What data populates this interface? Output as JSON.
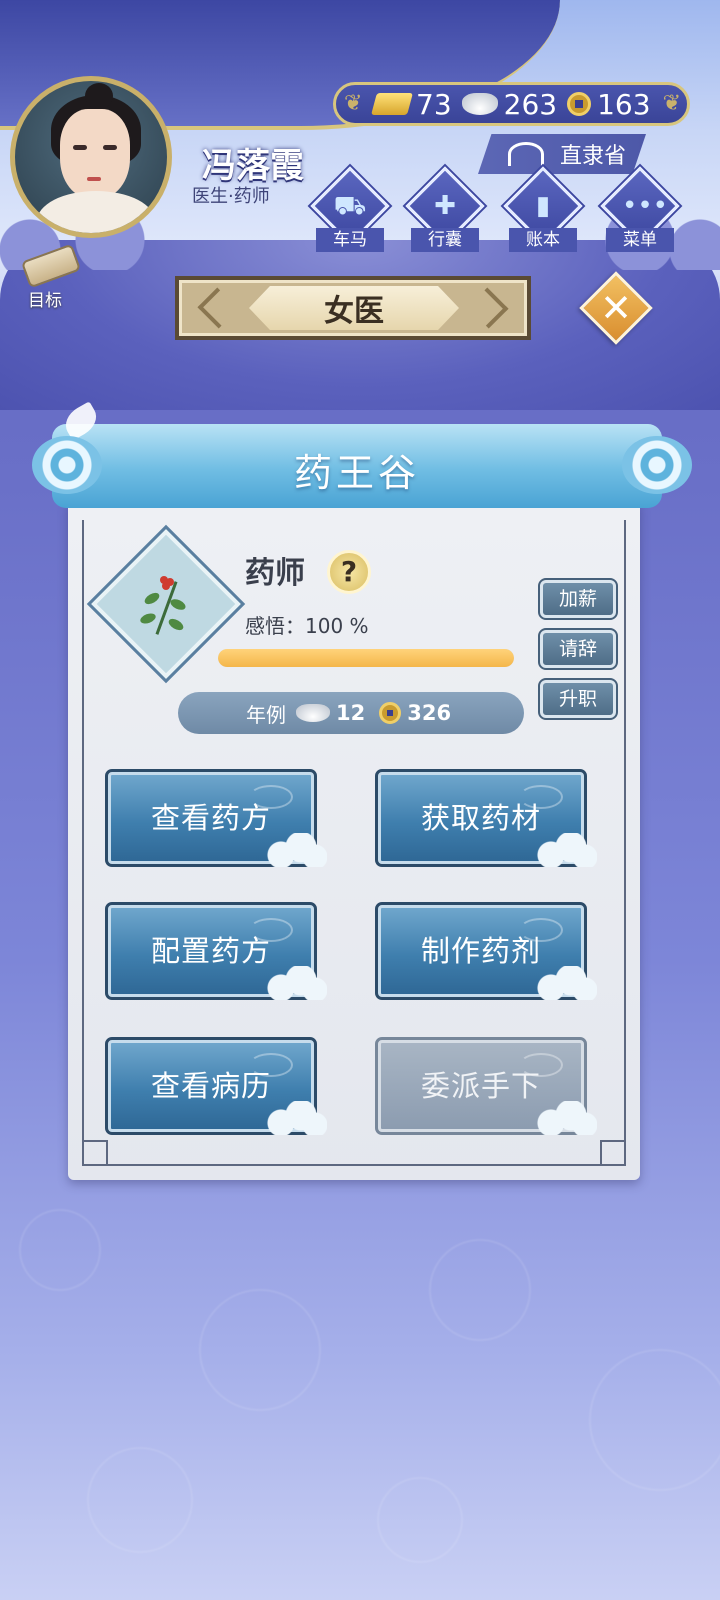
{
  "player": {
    "name": "冯落霞",
    "title": "医生·药师"
  },
  "currency": {
    "gold": "73",
    "silver": "263",
    "copper": "163"
  },
  "region": "直隶省",
  "nav": [
    {
      "label": "车马",
      "icon": "carriage-icon"
    },
    {
      "label": "行囊",
      "icon": "bundle-icon"
    },
    {
      "label": "账本",
      "icon": "ledger-icon"
    },
    {
      "label": "菜单",
      "icon": "menu-icon"
    }
  ],
  "goal_label": "目标",
  "job_title": "女医",
  "place": "药王谷",
  "job": {
    "name": "药师",
    "help_symbol": "?",
    "insight_label": "感悟：100 %",
    "insight_progress": 1.0
  },
  "side_buttons": [
    "加薪",
    "请辞",
    "升职"
  ],
  "salary": {
    "label": "年例",
    "silver": "12",
    "copper": "326"
  },
  "actions": [
    {
      "label": "查看药方",
      "enabled": true
    },
    {
      "label": "获取药材",
      "enabled": true
    },
    {
      "label": "配置药方",
      "enabled": true
    },
    {
      "label": "制作药剂",
      "enabled": true
    },
    {
      "label": "查看病历",
      "enabled": true
    },
    {
      "label": "委派手下",
      "enabled": false
    }
  ],
  "close_symbol": "✕"
}
